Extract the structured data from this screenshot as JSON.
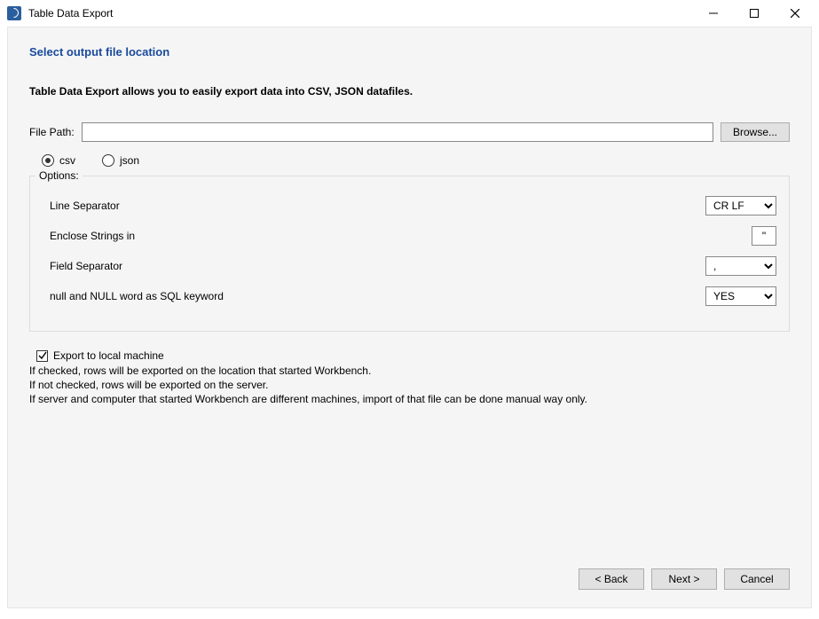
{
  "window": {
    "title": "Table Data Export"
  },
  "page": {
    "header": "Select output file location",
    "intro": "Table Data Export allows you to easily export data into CSV, JSON datafiles."
  },
  "filepath": {
    "label": "File Path:",
    "value": "",
    "browse": "Browse..."
  },
  "formats": {
    "csv": "csv",
    "json": "json",
    "selected": "csv"
  },
  "options": {
    "legend": "Options:",
    "line_separator": {
      "label": "Line Separator",
      "value": "CR LF"
    },
    "enclose_strings": {
      "label": "Enclose Strings in",
      "value": "\""
    },
    "field_separator": {
      "label": "Field Separator",
      "value": ","
    },
    "null_keyword": {
      "label": "null and NULL word as SQL keyword",
      "value": "YES"
    }
  },
  "export_local": {
    "label": "Export to local machine",
    "line1": "If checked, rows will be exported on the location that started Workbench.",
    "line2": "If not checked, rows will be exported on the server.",
    "line3": "If server and computer that started Workbench are different machines, import of that file can be done manual way only."
  },
  "buttons": {
    "back": "< Back",
    "next": "Next >",
    "cancel": "Cancel"
  }
}
